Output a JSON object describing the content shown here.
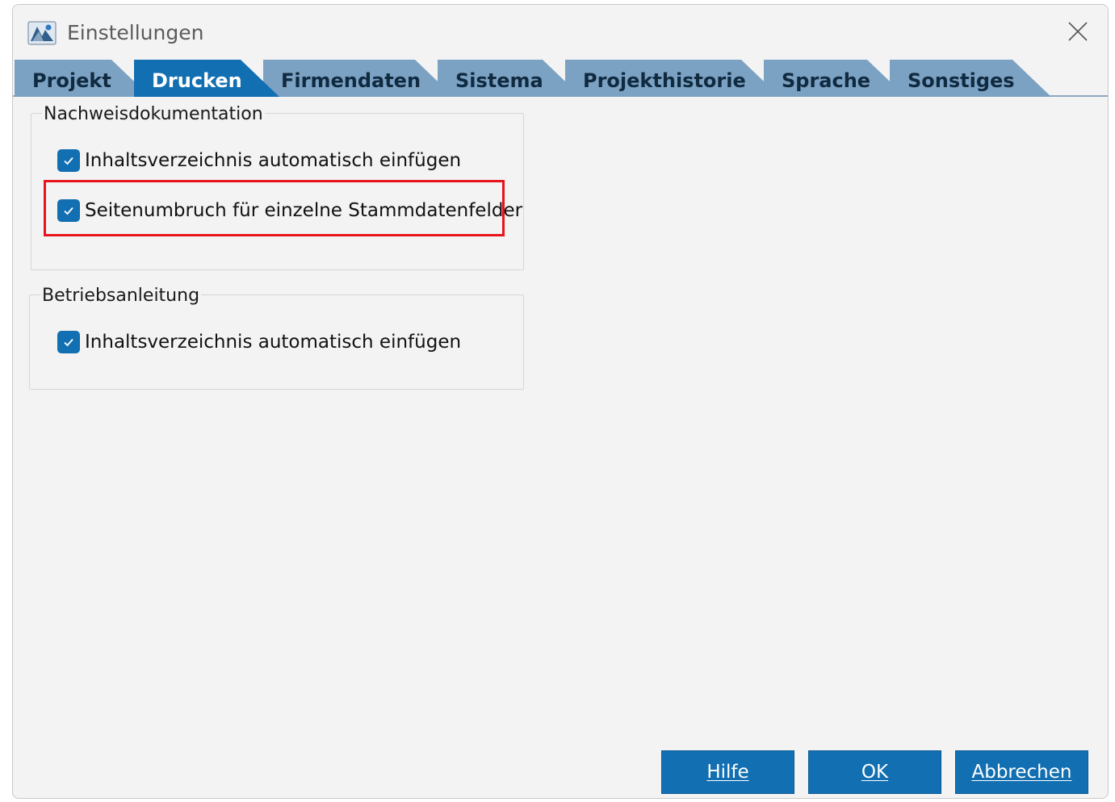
{
  "window": {
    "title": "Einstellungen",
    "icon": "app-logo-icon",
    "close_icon": "close-icon"
  },
  "tabs": [
    {
      "label": "Projekt",
      "active": false
    },
    {
      "label": "Drucken",
      "active": true
    },
    {
      "label": "Firmendaten",
      "active": false
    },
    {
      "label": "Sistema",
      "active": false
    },
    {
      "label": "Projekthistorie",
      "active": false
    },
    {
      "label": "Sprache",
      "active": false
    },
    {
      "label": "Sonstiges",
      "active": false
    }
  ],
  "groups": {
    "nachweis": {
      "legend": "Nachweisdokumentation",
      "items": [
        {
          "label": "Inhaltsverzeichnis automatisch einfügen",
          "checked": true
        },
        {
          "label": "Seitenumbruch für einzelne Stammdatenfelder",
          "checked": true,
          "highlighted": true
        }
      ]
    },
    "betrieb": {
      "legend": "Betriebsanleitung",
      "items": [
        {
          "label": "Inhaltsverzeichnis automatisch einfügen",
          "checked": true
        }
      ]
    }
  },
  "buttons": {
    "help": "Hilfe",
    "ok": "OK",
    "cancel": "Abbrechen"
  },
  "colors": {
    "accent": "#126fb2",
    "tab_inactive": "#7ba1c3",
    "highlight": "#e8141b"
  }
}
